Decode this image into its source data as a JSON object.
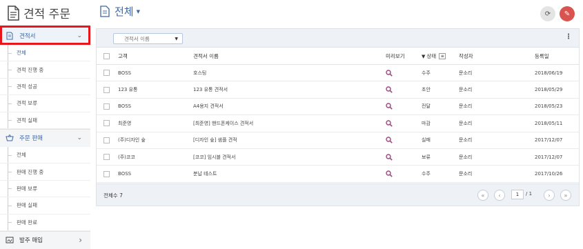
{
  "app": {
    "title": "견적 주문"
  },
  "sidebar": {
    "sections": [
      {
        "label": "견적서",
        "icon": "document-icon",
        "chevron": "⌄",
        "items": [
          "전체",
          "견적 진행 중",
          "견적 성공",
          "견적 보류",
          "견적 실패"
        ]
      },
      {
        "label": "주문 판매",
        "icon": "basket-icon",
        "chevron": "⌄",
        "items": [
          "전체",
          "판매 진행 중",
          "판매 보류",
          "판매 실패",
          "판매 완료"
        ]
      },
      {
        "label": "발주 매입",
        "icon": "signature-icon",
        "chevron": "›",
        "items": []
      }
    ]
  },
  "main": {
    "title": "전체",
    "toolbar": {
      "select_value": "견적서 이름"
    },
    "table": {
      "headers": {
        "client": "고객",
        "name": "견적서 이름",
        "preview": "미리보기",
        "status": "상태",
        "author": "작성자",
        "date": "등록일"
      },
      "rows": [
        {
          "client": "BOSS",
          "name": "호스팅",
          "status": "수주",
          "author": "문소리",
          "date": "2018/06/19"
        },
        {
          "client": "123 유통",
          "name": "123 유통 견적서",
          "status": "초안",
          "author": "문소리",
          "date": "2018/05/29"
        },
        {
          "client": "BOSS",
          "name": "A4용지 견적서",
          "status": "전달",
          "author": "문소리",
          "date": "2018/05/23"
        },
        {
          "client": "최준영",
          "name": "[최준영] 핸드폰케이스 견적서",
          "status": "마감",
          "author": "문소리",
          "date": "2018/05/11"
        },
        {
          "client": "(주)디자인 숲",
          "name": "[디자인 숲] 샘플 견적",
          "status": "실패",
          "author": "문소리",
          "date": "2017/12/07"
        },
        {
          "client": "(주)코코",
          "name": "[코코] 임시블 견적서",
          "status": "보류",
          "author": "문소리",
          "date": "2017/12/07"
        },
        {
          "client": "BOSS",
          "name": "분납 테스트",
          "status": "수주",
          "author": "문소리",
          "date": "2017/10/26"
        }
      ]
    },
    "footer": {
      "total": "전체수 7",
      "page": "1",
      "of": "/ 1"
    }
  },
  "colors": {
    "accent": "#3a67a8",
    "highlight": "#e8151b",
    "edit_button": "#d9534f",
    "preview_icon": "#a0447f"
  }
}
